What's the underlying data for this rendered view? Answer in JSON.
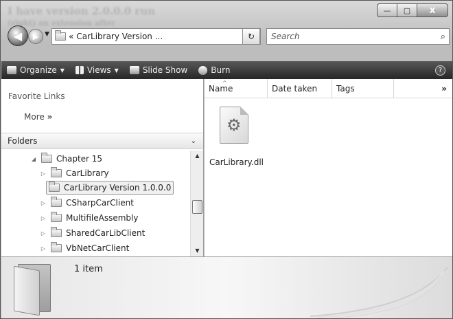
{
  "window": {
    "title_ghost_lines": [
      "I have version 2.0.0.0 run",
      "(right) an extension after"
    ],
    "caption_buttons": {
      "minimize": "—",
      "maximize": "▢",
      "close": "X"
    }
  },
  "navigation": {
    "back_glyph": "◀",
    "forward_glyph": "▶",
    "address_prefix": "«",
    "address_text": "CarLibrary Version ...",
    "refresh_glyph": "↻",
    "search_placeholder": "Search",
    "search_glyph": "⌕"
  },
  "toolbar": {
    "items": [
      {
        "label": "Organize",
        "has_caret": true
      },
      {
        "label": "Views",
        "has_caret": true
      },
      {
        "label": "Slide Show",
        "has_caret": false
      },
      {
        "label": "Burn",
        "has_caret": false
      }
    ],
    "help_glyph": "?"
  },
  "nav_pane": {
    "favorite_links_title": "Favorite Links",
    "more_label": "More",
    "more_glyph": "»",
    "folders_title": "Folders",
    "folders_glyph": "⌄",
    "tree": [
      {
        "label": "Chapter 15",
        "expander": "◢",
        "selected": false
      },
      {
        "label": "CarLibrary",
        "expander": "▷",
        "selected": false
      },
      {
        "label": "CarLibrary Version 1.0.0.0",
        "expander": "",
        "selected": true
      },
      {
        "label": "CSharpCarClient",
        "expander": "▷",
        "selected": false
      },
      {
        "label": "MultifileAssembly",
        "expander": "▷",
        "selected": false
      },
      {
        "label": "SharedCarLibClient",
        "expander": "▷",
        "selected": false
      },
      {
        "label": "VbNetCarClient",
        "expander": "▷",
        "selected": false
      }
    ]
  },
  "file_list": {
    "columns": [
      "Name",
      "Date taken",
      "Tags"
    ],
    "more_columns_glyph": "»",
    "files": [
      {
        "name": "CarLibrary.dll",
        "icon": "dll-gears-icon"
      }
    ]
  },
  "details_pane": {
    "item_count": "1 item"
  }
}
